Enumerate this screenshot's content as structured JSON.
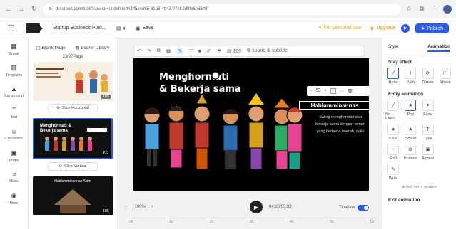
{
  "browser": {
    "url": "doratoon.com/tool/?source=undefined#/9f5a4e65-61a3-4b43-97ef-2d9fe6e6848f"
  },
  "topbar": {
    "project_title": "Startup Business Plan...",
    "save_label": "Save",
    "personal_label": "For personal use",
    "upgrade_label": "Upgrade",
    "publish_label": "Publish"
  },
  "left_rail": [
    {
      "label": "Scene",
      "icon": "scene-icon"
    },
    {
      "label": "Templates",
      "icon": "templates-icon"
    },
    {
      "label": "Background",
      "icon": "background-icon"
    },
    {
      "label": "Text",
      "icon": "text-icon"
    },
    {
      "label": "Characters",
      "icon": "characters-icon"
    },
    {
      "label": "Props",
      "icon": "props-icon"
    },
    {
      "label": "Music",
      "icon": "music-icon"
    },
    {
      "label": "More",
      "icon": "more-icon"
    }
  ],
  "scene_panel": {
    "tab_blank": "Blank Page",
    "tab_library": "Scene Library",
    "page_count": "23/27Page",
    "slice_horizontal": "Slice Horizontal",
    "slice_vertical": "Slice Vertical",
    "thumb1_time": "10S",
    "thumb2_time": "6S",
    "thumb2_title": "Menghormati & Bekerja sama",
    "thumb3_title": "Hablumminannas Alam",
    "thumb3_time": "10S"
  },
  "canvas": {
    "title_line1": "Menghormati",
    "title_line2": "& Bekerja sama",
    "textbox": "Hablumminannas",
    "body": "Saling menghormati dan bekerja sama dengan teman yang berbeda daerah, suku",
    "font_size": "55",
    "sound_label": "sound & subtitle",
    "layer_label": "169"
  },
  "playbar": {
    "zoom": "100%",
    "time": "04:28/05:33",
    "timeline_label": "Timeline",
    "ticks": [
      "0s",
      "1s",
      "2s",
      "3s",
      "4s",
      "5s",
      "6s"
    ]
  },
  "right_panel": {
    "tab_style": "Style",
    "tab_animation": "Animation",
    "stay_effect": "Stay effect",
    "stay_items": [
      "None",
      "Path",
      "Rotate",
      "Shake"
    ],
    "entry_animation": "Entry animation",
    "entry_items": [
      "No Effect",
      "Pop",
      "Fade",
      "Slide",
      "Smear",
      "Type",
      "Roll",
      "Bounce",
      "Appear",
      "Write"
    ],
    "add_entry": "Add entry gesture",
    "exit_animation": "Exit animation"
  }
}
